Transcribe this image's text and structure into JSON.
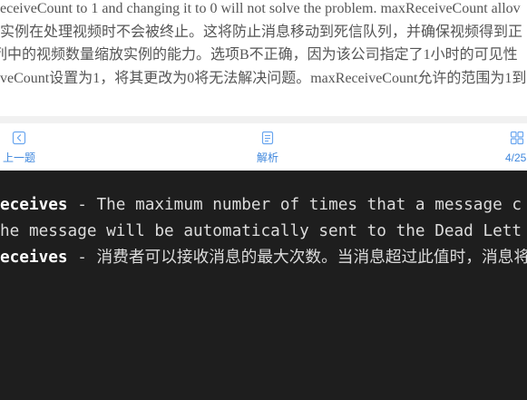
{
  "explanation": {
    "lines": [
      "eceiveCount to 1 and changing it to 0 will not solve the problem. maxReceiveCount allov",
      "实例在处理视频时不会被终止。这将防止消息移动到死信队列，并确保视频得到正",
      "列中的视频数量缩放实例的能力。选项B不正确，因为该公司指定了1小时的可见性",
      "veCount设置为1，将其更改为0将无法解决问题。maxReceiveCount允许的范围为1到"
    ]
  },
  "nav": {
    "prev": {
      "label": "上一题",
      "icon": "chevron-left-icon"
    },
    "analysis": {
      "label": "解析",
      "icon": "document-icon"
    },
    "progress": {
      "label": "4/25",
      "icon": "grid-icon"
    }
  },
  "code_block": {
    "lines": [
      {
        "term": "eceives",
        "text": " - The maximum number of times that a message c"
      },
      {
        "text": "he message will be automatically sent to the Dead Lett"
      },
      {
        "term": "eceives",
        "text": " - 消费者可以接收消息的最大次数。当消息超过此值时，消息将"
      }
    ]
  },
  "colors": {
    "accent_icon": "#6aa6ef",
    "accent_label": "#3f87dd",
    "divider": "#f1f1f1",
    "body_text": "#555555",
    "code_bg": "#1e1e1e",
    "code_text": "#dcdcdc",
    "code_term": "#ffffff"
  }
}
